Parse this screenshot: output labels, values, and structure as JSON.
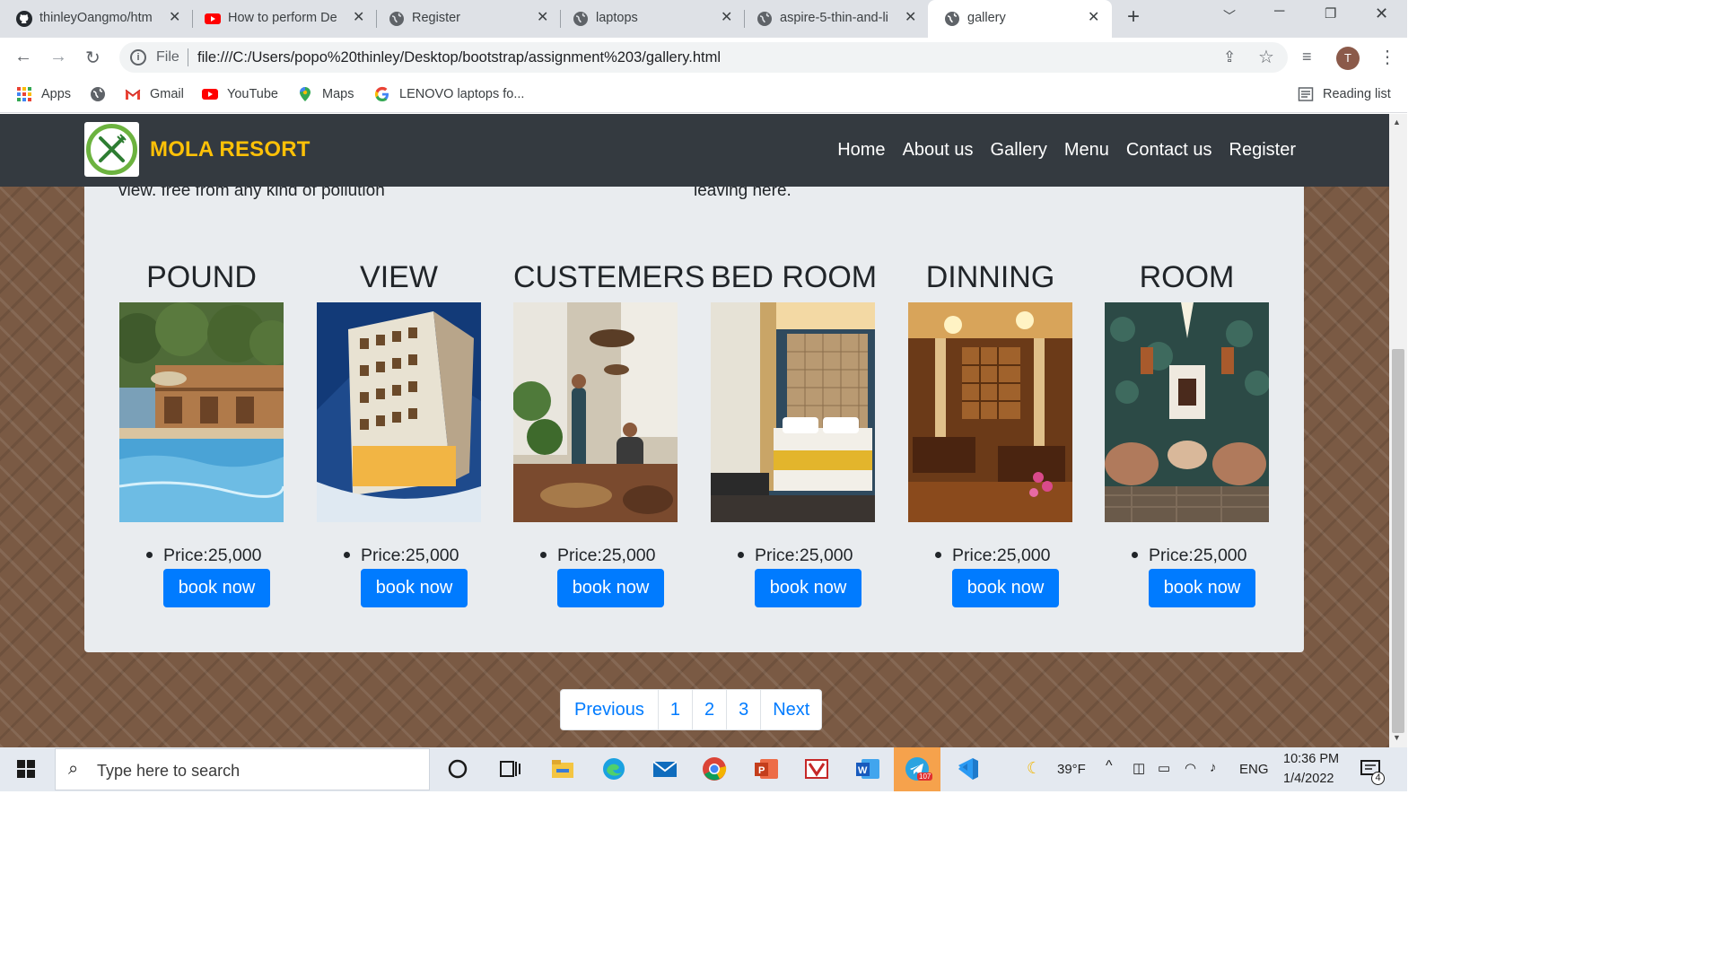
{
  "browser": {
    "tabs": [
      {
        "title": "thinleyOangmo/htm",
        "icon": "github-icon"
      },
      {
        "title": "How to perform De",
        "icon": "youtube-icon"
      },
      {
        "title": "Register",
        "icon": "globe-icon"
      },
      {
        "title": "laptops",
        "icon": "globe-icon"
      },
      {
        "title": "aspire-5-thin-and-li",
        "icon": "globe-icon"
      },
      {
        "title": "gallery",
        "icon": "globe-icon",
        "active": true
      }
    ],
    "new_tab": "+",
    "omnibox": {
      "scheme_label": "File",
      "url": "file:///C:/Users/popo%20thinley/Desktop/bootstrap/assignment%203/gallery.html"
    },
    "profile_initial": "T",
    "bookmarks": [
      {
        "label": "Apps",
        "icon": "apps-grid-icon"
      },
      {
        "label": "",
        "icon": "globe-icon"
      },
      {
        "label": "Gmail",
        "icon": "gmail-icon"
      },
      {
        "label": "YouTube",
        "icon": "youtube-icon"
      },
      {
        "label": "Maps",
        "icon": "maps-icon"
      },
      {
        "label": "LENOVO laptops fo...",
        "icon": "google-icon"
      }
    ],
    "reading_list": "Reading list"
  },
  "site": {
    "brand": "MOLA RESORT",
    "nav": [
      "Home",
      "About us",
      "Gallery",
      "Menu",
      "Contact us",
      "Register"
    ],
    "cut_text_left": "view. free from any kind of pollution",
    "cut_text_right": "leaving here.",
    "gallery": [
      {
        "title": "POUND",
        "price": "Price:25,000",
        "button": "book now"
      },
      {
        "title": "VIEW",
        "price": "Price:25,000",
        "button": "book now"
      },
      {
        "title": "CUSTEMERS",
        "price": "Price:25,000",
        "button": "book now"
      },
      {
        "title": "BED ROOM",
        "price": "Price:25,000",
        "button": "book now"
      },
      {
        "title": "DINNING",
        "price": "Price:25,000",
        "button": "book now"
      },
      {
        "title": "ROOM",
        "price": "Price:25,000",
        "button": "book now"
      }
    ],
    "pagination": [
      "Previous",
      "1",
      "2",
      "3",
      "Next"
    ],
    "colors": {
      "navbar": "#343a40",
      "brand": "#ffc107",
      "primary": "#007bff",
      "card": "#e9ecef"
    }
  },
  "taskbar": {
    "search_placeholder": "Type here to search",
    "weather": "39°F",
    "language": "ENG",
    "time": "10:36 PM",
    "date": "1/4/2022",
    "notification_count": "4",
    "telegram_badge": "107"
  }
}
